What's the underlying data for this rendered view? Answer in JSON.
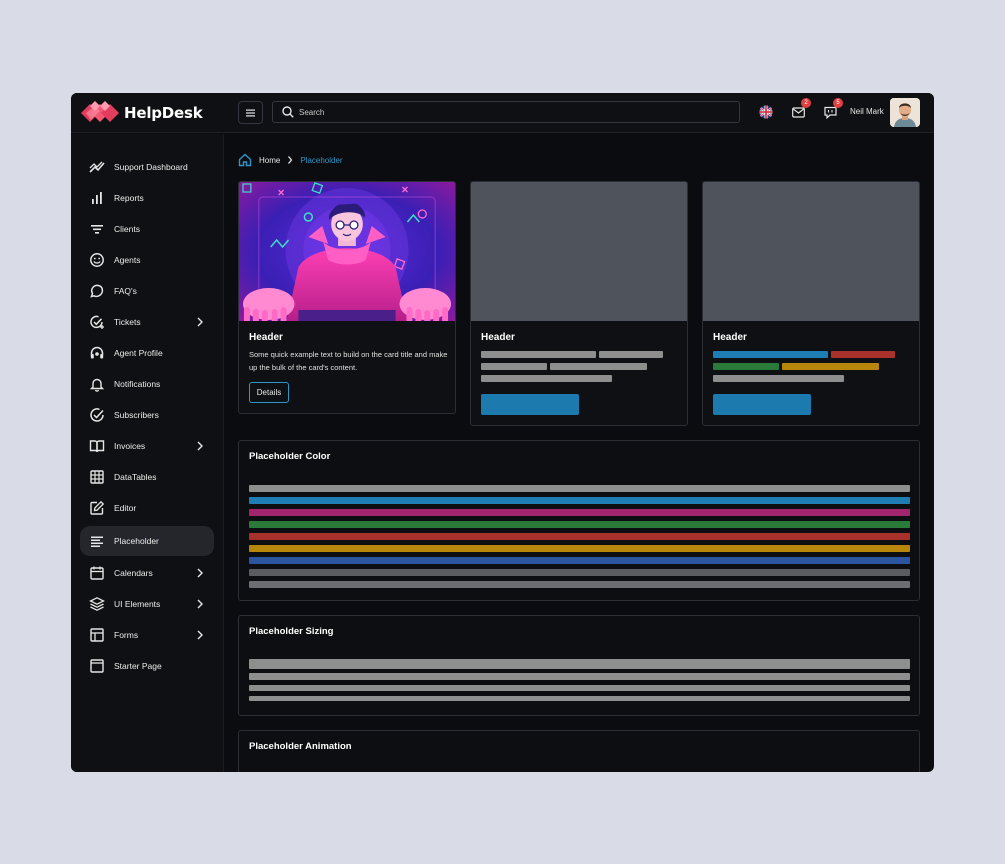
{
  "brand": {
    "name": "HelpDesk"
  },
  "search": {
    "placeholder": "Search"
  },
  "topbar": {
    "mail_badge": "2",
    "chat_badge": "5",
    "user_name": "Neil Mark"
  },
  "sidebar": {
    "items": [
      {
        "label": "Support Dashboard",
        "icon": "trending-icon"
      },
      {
        "label": "Reports",
        "icon": "bar-chart-icon"
      },
      {
        "label": "Clients",
        "icon": "filter-icon"
      },
      {
        "label": "Agents",
        "icon": "smile-icon"
      },
      {
        "label": "FAQ's",
        "icon": "message-circle-icon"
      },
      {
        "label": "Tickets",
        "icon": "check-circle-plus-icon",
        "has_submenu": true
      },
      {
        "label": "Agent Profile",
        "icon": "headset-icon"
      },
      {
        "label": "Notifications",
        "icon": "bell-icon"
      },
      {
        "label": "Subscribers",
        "icon": "check-circle-icon"
      },
      {
        "label": "Invoices",
        "icon": "book-open-icon",
        "has_submenu": true
      },
      {
        "label": "DataTables",
        "icon": "grid-icon"
      },
      {
        "label": "Editor",
        "icon": "edit-icon"
      },
      {
        "label": "Placeholder",
        "icon": "align-left-icon",
        "active": true
      },
      {
        "label": "Calendars",
        "icon": "calendar-icon",
        "has_submenu": true
      },
      {
        "label": "UI Elements",
        "icon": "layers-icon",
        "has_submenu": true
      },
      {
        "label": "Forms",
        "icon": "layout-icon",
        "has_submenu": true
      },
      {
        "label": "Starter Page",
        "icon": "page-icon"
      }
    ]
  },
  "breadcrumb": {
    "home": "Home",
    "current": "Placeholder"
  },
  "cards": [
    {
      "header": "Header",
      "text": "Some quick example text to build on the card title and make up the bulk of the card's content.",
      "button": "Details"
    },
    {
      "header": "Header"
    },
    {
      "header": "Header"
    }
  ],
  "sections": {
    "color": {
      "title": "Placeholder Color"
    },
    "sizing": {
      "title": "Placeholder Sizing"
    },
    "animation": {
      "title": "Placeholder Animation"
    }
  },
  "colors": {
    "accent": "#2f96c8",
    "placeholder_gray": "#8e8e8e",
    "primary": "#1e7eb4",
    "secondary": "#a0256d",
    "success": "#2a7a3a",
    "danger": "#a8322b",
    "warning": "#b8860b",
    "info": "#2c55a0",
    "dark": "#5a5c62",
    "light": "#6c6e74"
  }
}
